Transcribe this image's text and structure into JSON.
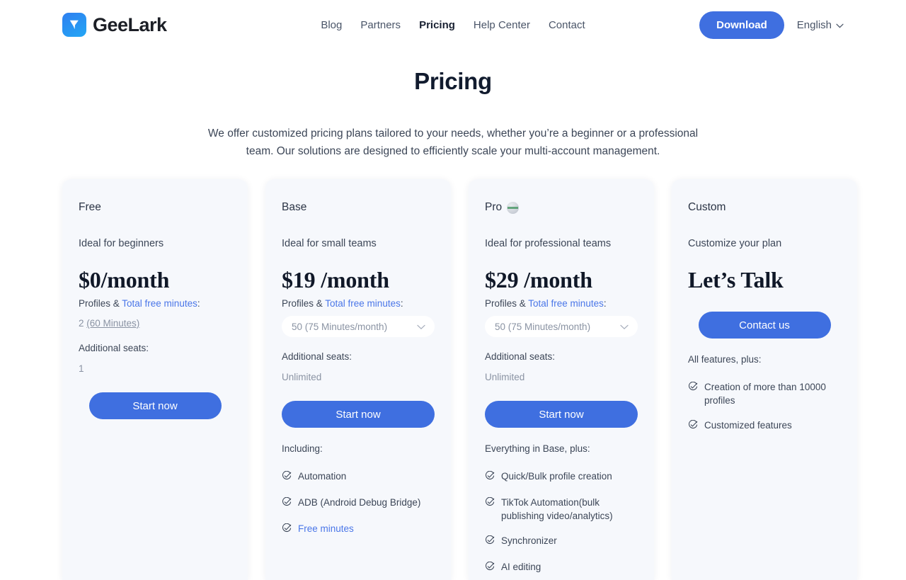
{
  "brand": {
    "name": "GeeLark",
    "logo_icon": "geelark-bird-logo",
    "accent": "#3f6fe0"
  },
  "nav": {
    "items": [
      {
        "label": "Blog",
        "active": false
      },
      {
        "label": "Partners",
        "active": false
      },
      {
        "label": "Pricing",
        "active": true
      },
      {
        "label": "Help Center",
        "active": false
      },
      {
        "label": "Contact",
        "active": false
      }
    ],
    "download_label": "Download",
    "language_label": "English",
    "language_icon": "chevron-down-icon"
  },
  "hero": {
    "title": "Pricing",
    "subtitle": "We offer customized pricing plans tailored to your needs, whether you’re a beginner or a professional team. Our solutions are designed to efficiently scale your multi-account management."
  },
  "plans": [
    {
      "name": "Free",
      "badge": null,
      "tagline": "Ideal for beginners",
      "price": "$0/month",
      "profiles_label_prefix": "Profiles & ",
      "profiles_link": "Total free minutes",
      "profiles_label_suffix": ":",
      "profiles_value_prefix": "2 ",
      "profiles_value_underlined": "(60 Minutes)",
      "seats_label": "Additional seats:",
      "seats_value": "1",
      "cta": "Start now",
      "features_title": null,
      "features": []
    },
    {
      "name": "Base",
      "badge": null,
      "tagline": "Ideal for small teams",
      "price": "$19 /month",
      "profiles_label_prefix": "Profiles & ",
      "profiles_link": "Total free minutes",
      "profiles_label_suffix": ":",
      "select_value": "50 (75 Minutes/month)",
      "select_icon": "chevron-down-icon",
      "seats_label": "Additional seats:",
      "seats_value": "Unlimited",
      "cta": "Start now",
      "features_title": "Including:",
      "features": [
        {
          "label": "Automation",
          "is_link": false
        },
        {
          "label": "ADB (Android Debug Bridge)",
          "is_link": false
        },
        {
          "label": "Free minutes",
          "is_link": true
        }
      ]
    },
    {
      "name": "Pro",
      "badge": "pro-badge-icon",
      "tagline": "Ideal for professional teams",
      "price": "$29 /month",
      "profiles_label_prefix": "Profiles & ",
      "profiles_link": "Total free minutes",
      "profiles_label_suffix": ":",
      "select_value": "50 (75 Minutes/month)",
      "select_icon": "chevron-down-icon",
      "seats_label": "Additional seats:",
      "seats_value": "Unlimited",
      "cta": "Start now",
      "features_title": "Everything in Base, plus:",
      "features": [
        {
          "label": "Quick/Bulk profile creation",
          "is_link": false
        },
        {
          "label": "TikTok Automation(bulk publishing video/analytics)",
          "is_link": false
        },
        {
          "label": "Synchronizer",
          "is_link": false
        },
        {
          "label": "AI editing",
          "is_link": false
        }
      ]
    },
    {
      "name": "Custom",
      "badge": null,
      "tagline": "Customize your plan",
      "price": "Let’s Talk",
      "cta": "Contact us",
      "features_title": "All features, plus:",
      "features": [
        {
          "label": "Creation of more than 10000 profiles",
          "is_link": false
        },
        {
          "label": "Customized features",
          "is_link": false
        }
      ]
    }
  ]
}
